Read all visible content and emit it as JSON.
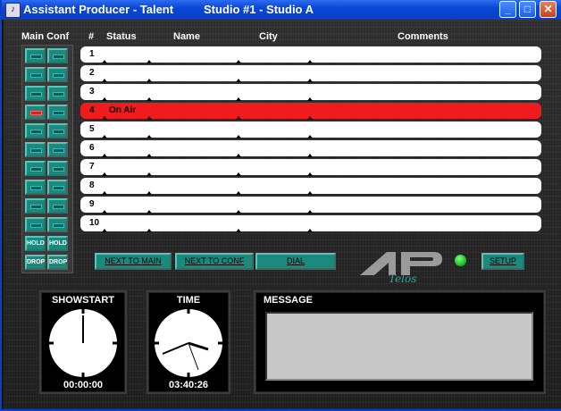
{
  "window": {
    "title": "Assistant Producer - Talent",
    "subtitle": "Studio #1 - Studio A",
    "minimize_glyph": "_",
    "maximize_glyph": "□",
    "close_glyph": "✕"
  },
  "sidebar": {
    "header": "Main Conf",
    "active_main_row": 4,
    "hold_label": "HOLD",
    "drop_label": "DROP"
  },
  "list_headers": {
    "num": "#",
    "status": "Status",
    "name": "Name",
    "city": "City",
    "comments": "Comments"
  },
  "lines": [
    {
      "num": "1",
      "status": ""
    },
    {
      "num": "2",
      "status": ""
    },
    {
      "num": "3",
      "status": ""
    },
    {
      "num": "4",
      "status": "On Air",
      "color": "#ee1c1c"
    },
    {
      "num": "5",
      "status": ""
    },
    {
      "num": "6",
      "status": ""
    },
    {
      "num": "7",
      "status": ""
    },
    {
      "num": "8",
      "status": ""
    },
    {
      "num": "9",
      "status": ""
    },
    {
      "num": "10",
      "status": ""
    }
  ],
  "actions": {
    "next_to_main": "NEXT TO MAIN",
    "next_to_conf": "NEXT TO CONF",
    "dial": "DIAL",
    "setup": "SETUP"
  },
  "status_led_color": "#1fc41f",
  "logo": {
    "text": "AP",
    "script": "Telos"
  },
  "showstart": {
    "title": "SHOWSTART",
    "time": "00:00:00"
  },
  "clock": {
    "title": "TIME",
    "time": "03:40:26"
  },
  "message": {
    "title": "MESSAGE",
    "text": ""
  },
  "colors": {
    "accent_teal": "#1b8a7e",
    "on_air": "#ee1c1c",
    "titlebar": "#0a46d8"
  }
}
